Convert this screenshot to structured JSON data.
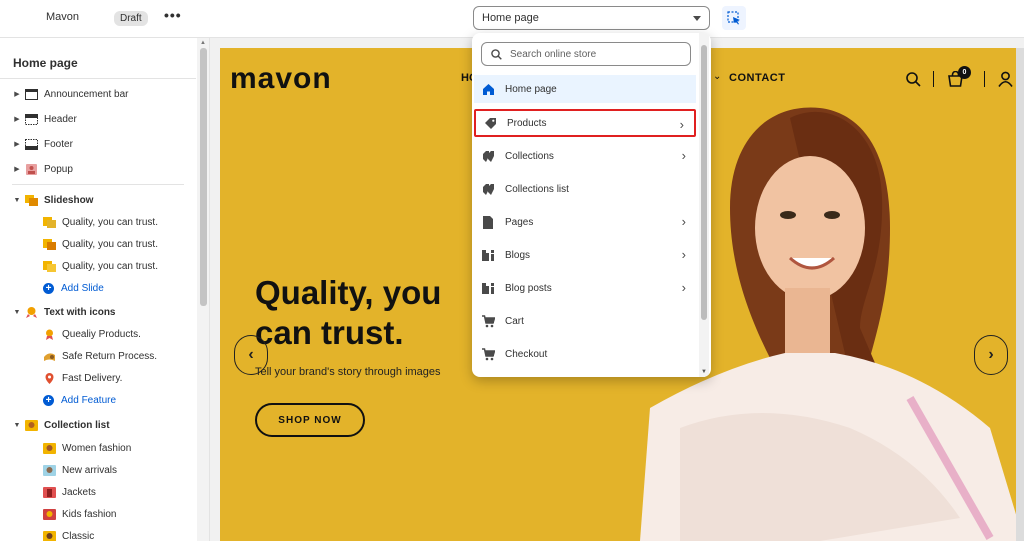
{
  "topbar": {
    "theme_name": "Mavon",
    "status_badge": "Draft",
    "more_label": "•••",
    "page_selector": "Home page"
  },
  "sidebar": {
    "title": "Home page",
    "header_sections": [
      {
        "label": "Announcement bar",
        "icon": "announcement-bar-icon"
      },
      {
        "label": "Header",
        "icon": "header-icon"
      },
      {
        "label": "Footer",
        "icon": "footer-icon"
      },
      {
        "label": "Popup",
        "icon": "popup-icon"
      }
    ],
    "slideshow": {
      "label": "Slideshow",
      "items": [
        "Quality, you can trust.",
        "Quality, you can trust.",
        "Quality, you can trust."
      ],
      "add_label": "Add Slide"
    },
    "text_with_icons": {
      "label": "Text with icons",
      "items": [
        "Quealiy Products.",
        "Safe Return Process.",
        "Fast Delivery."
      ],
      "add_label": "Add Feature"
    },
    "collection_list": {
      "label": "Collection list",
      "items": [
        "Women fashion",
        "New arrivals",
        "Jackets",
        "Kids fashion",
        "Classic"
      ]
    }
  },
  "preview": {
    "logo": "mavon",
    "nav_partial": "HO",
    "nav_contact": "CONTACT",
    "cart_count": "0",
    "hero_title": "Quality, you can trust.",
    "hero_subtitle": "Tell your brand's story through images",
    "shop_button": "SHOP NOW",
    "bg_color": "#e3b32a"
  },
  "dropdown": {
    "search_placeholder": "Search online store",
    "items": [
      {
        "label": "Home page",
        "icon": "home-icon",
        "has_submenu": false,
        "state": "selected"
      },
      {
        "label": "Products",
        "icon": "tag-icon",
        "has_submenu": true,
        "state": "highlighted"
      },
      {
        "label": "Collections",
        "icon": "collections-icon",
        "has_submenu": true
      },
      {
        "label": "Collections list",
        "icon": "collections-icon",
        "has_submenu": false
      },
      {
        "label": "Pages",
        "icon": "page-icon",
        "has_submenu": true
      },
      {
        "label": "Blogs",
        "icon": "blog-icon",
        "has_submenu": true
      },
      {
        "label": "Blog posts",
        "icon": "blog-icon",
        "has_submenu": true
      },
      {
        "label": "Cart",
        "icon": "cart-icon",
        "has_submenu": false
      },
      {
        "label": "Checkout",
        "icon": "cart-icon",
        "has_submenu": false
      }
    ]
  },
  "colors": {
    "accent_blue": "#005bd3",
    "highlight_red": "#e02020",
    "preview_yellow": "#e3b32a"
  }
}
